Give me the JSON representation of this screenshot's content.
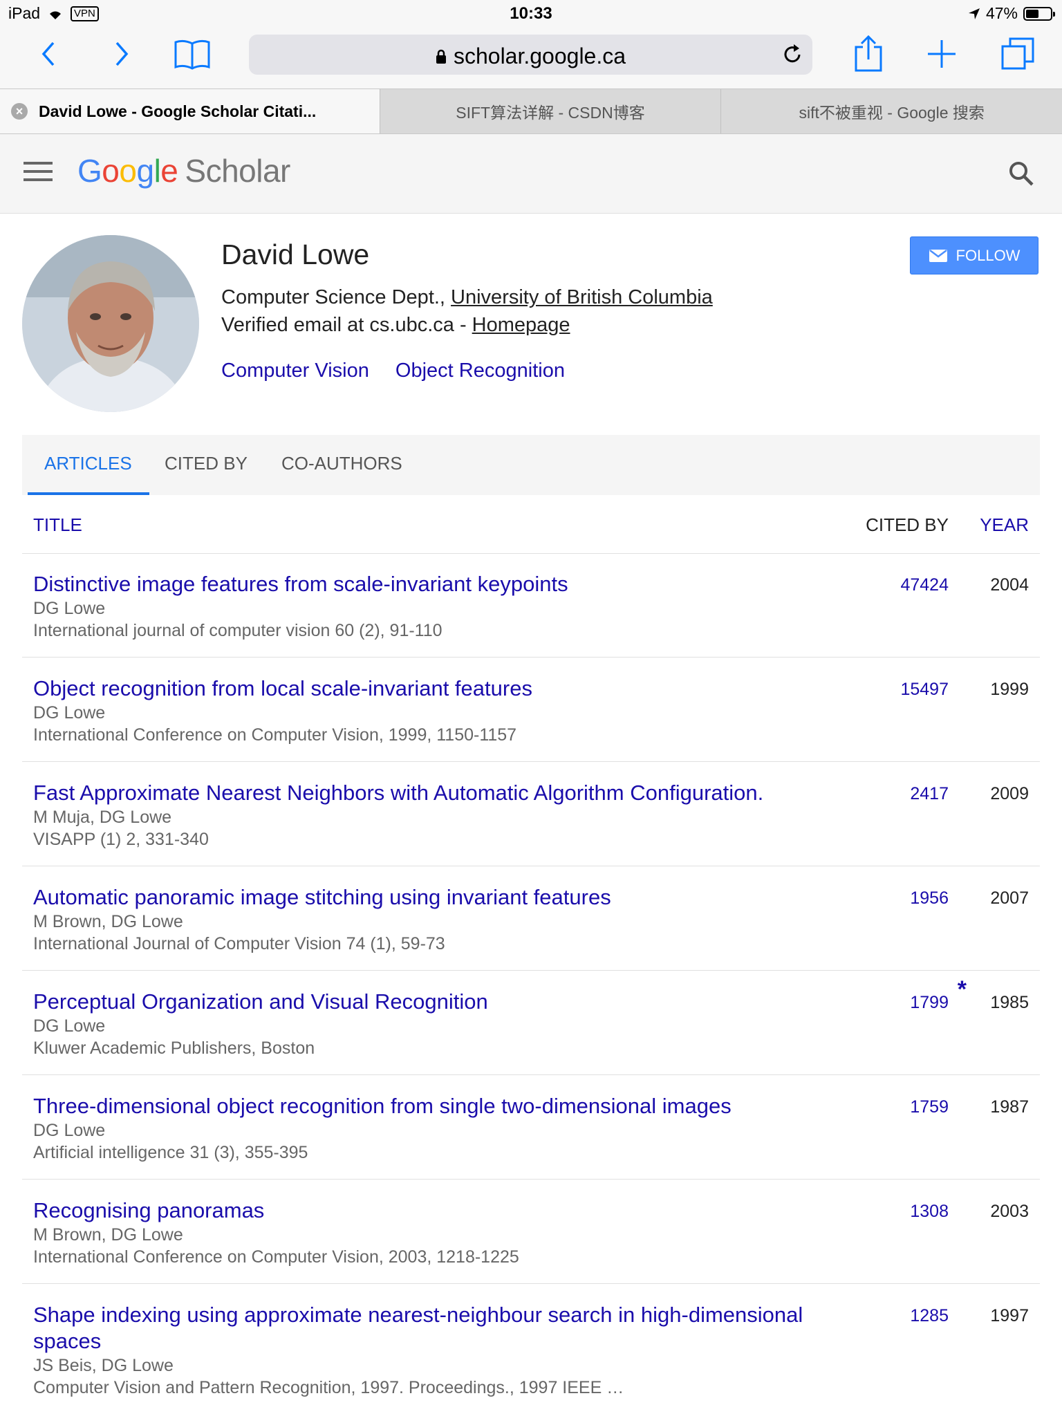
{
  "status": {
    "device": "iPad",
    "vpn": "VPN",
    "time": "10:33",
    "battery": "47%",
    "battery_level": 0.47
  },
  "browser": {
    "url": "scholar.google.ca",
    "tabs": [
      {
        "label": "David Lowe - Google Scholar Citati..."
      },
      {
        "label": "SIFT算法详解 - CSDN博客"
      },
      {
        "label": "sift不被重视 - Google 搜索"
      }
    ]
  },
  "header": {
    "logo_google": "Google",
    "logo_scholar": "Scholar"
  },
  "profile": {
    "name": "David Lowe",
    "affiliation_prefix": "Computer Science Dept., ",
    "affiliation_link": "University of British Columbia",
    "email_text": "Verified email at cs.ubc.ca - ",
    "homepage": "Homepage",
    "interests": [
      "Computer Vision",
      "Object Recognition"
    ],
    "follow_label": "FOLLOW"
  },
  "section_tabs": [
    "ARTICLES",
    "CITED BY",
    "CO-AUTHORS"
  ],
  "table": {
    "col_title": "TITLE",
    "col_cited": "CITED BY",
    "col_year": "YEAR",
    "rows": [
      {
        "title": "Distinctive image features from scale-invariant keypoints",
        "authors": "DG Lowe",
        "venue": "International journal of computer vision 60 (2), 91-110",
        "cites": "47424",
        "year": "2004"
      },
      {
        "title": "Object recognition from local scale-invariant features",
        "authors": "DG Lowe",
        "venue": "International Conference on Computer Vision, 1999, 1150-1157",
        "cites": "15497",
        "year": "1999"
      },
      {
        "title": "Fast Approximate Nearest Neighbors with Automatic Algorithm Configuration.",
        "authors": "M Muja, DG Lowe",
        "venue": "VISAPP (1) 2, 331-340",
        "cites": "2417",
        "year": "2009"
      },
      {
        "title": "Automatic panoramic image stitching using invariant features",
        "authors": "M Brown, DG Lowe",
        "venue": "International Journal of Computer Vision 74 (1), 59-73",
        "cites": "1956",
        "year": "2007"
      },
      {
        "title": "Perceptual Organization and Visual Recognition",
        "authors": "DG Lowe",
        "venue": "Kluwer Academic Publishers, Boston",
        "cites": "1799",
        "star": "*",
        "year": "1985"
      },
      {
        "title": "Three-dimensional object recognition from single two-dimensional images",
        "authors": "DG Lowe",
        "venue": "Artificial intelligence 31 (3), 355-395",
        "cites": "1759",
        "year": "1987"
      },
      {
        "title": "Recognising panoramas",
        "authors": "M Brown, DG Lowe",
        "venue": "International Conference on Computer Vision, 2003, 1218-1225",
        "cites": "1308",
        "year": "2003"
      },
      {
        "title": "Shape indexing using approximate nearest-neighbour search in high-dimensional spaces",
        "authors": "JS Beis, DG Lowe",
        "venue": "Computer Vision and Pattern Recognition, 1997. Proceedings., 1997 IEEE …",
        "cites": "1285",
        "year": "1997"
      }
    ]
  },
  "colors": {
    "link": "#1a0dab",
    "accent": "#1a73e8",
    "follow_bg": "#4d90fe"
  },
  "icons": [
    "back-icon",
    "forward-icon",
    "bookmarks-icon",
    "lock-icon",
    "reload-icon",
    "share-icon",
    "new-tab-icon",
    "tabs-icon",
    "menu-icon",
    "search-icon",
    "mail-icon",
    "wifi-icon",
    "location-icon",
    "battery-icon",
    "close-tab-icon"
  ]
}
